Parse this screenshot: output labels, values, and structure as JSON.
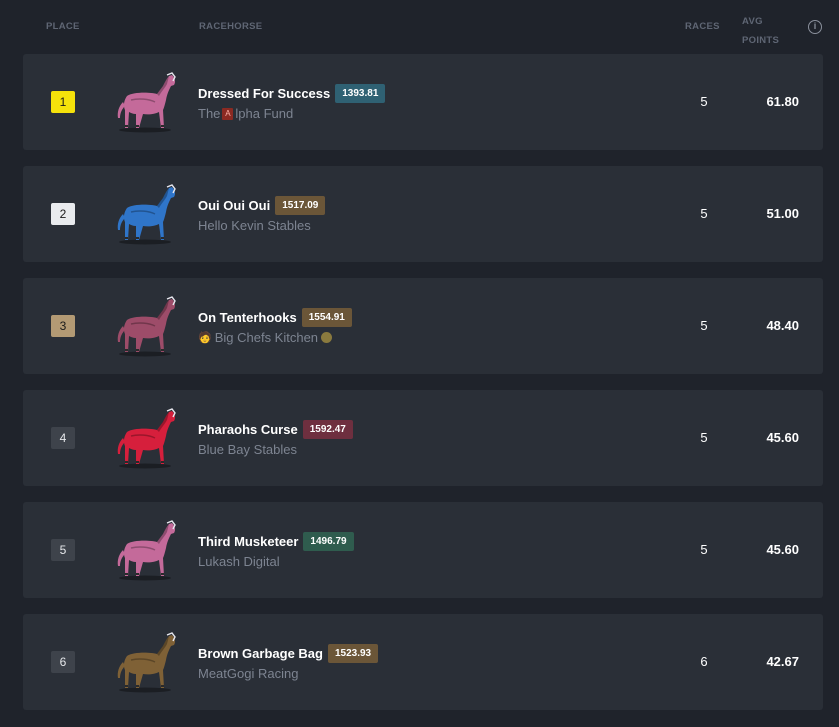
{
  "header": {
    "place": "PLACE",
    "racehorse": "RACEHORSE",
    "races": "RACES",
    "avg_line1": "AVG",
    "avg_line2": "POINTS",
    "info_icon": "info-icon"
  },
  "rows": [
    {
      "place": "1",
      "name": "Dressed For Success",
      "rating": "1393.81",
      "stable_pre": "The ",
      "stable_badge": "A",
      "stable_post": "lpha Fund",
      "races": "5",
      "avg": "61.80",
      "horse_color": "#c46a9a",
      "rating_color": "#2f6173",
      "place_bg": "#f5e20b",
      "place_fg": "#1a1a1a"
    },
    {
      "place": "2",
      "name": "Oui Oui Oui",
      "rating": "1517.09",
      "stable": "Hello Kevin Stables",
      "races": "5",
      "avg": "51.00",
      "horse_color": "#2f75c9",
      "rating_color": "#6b5638",
      "place_bg": "#e9ebee",
      "place_fg": "#1a1a1a"
    },
    {
      "place": "3",
      "name": "On Tenterhooks",
      "rating": "1554.91",
      "stable": "Big Chefs Kitchen",
      "races": "5",
      "avg": "48.40",
      "horse_color": "#9d4c69",
      "rating_color": "#6b5638",
      "place_bg": "#b39a74",
      "place_fg": "#1a1a1a"
    },
    {
      "place": "4",
      "name": "Pharaohs Curse",
      "rating": "1592.47",
      "stable": "Blue Bay Stables",
      "races": "5",
      "avg": "45.60",
      "horse_color": "#d61f3c",
      "rating_color": "#6e2f3f",
      "place_bg": "#3e434b",
      "place_fg": "#e6e8eb"
    },
    {
      "place": "5",
      "name": "Third Musketeer",
      "rating": "1496.79",
      "stable": "Lukash Digital",
      "races": "5",
      "avg": "45.60",
      "horse_color": "#c46a9a",
      "rating_color": "#2f5c4e",
      "place_bg": "#3e434b",
      "place_fg": "#e6e8eb"
    },
    {
      "place": "6",
      "name": "Brown Garbage Bag",
      "rating": "1523.93",
      "stable": "MeatGogi Racing",
      "races": "6",
      "avg": "42.67",
      "horse_color": "#7f6136",
      "rating_color": "#6b5638",
      "place_bg": "#3e434b",
      "place_fg": "#e6e8eb"
    }
  ]
}
